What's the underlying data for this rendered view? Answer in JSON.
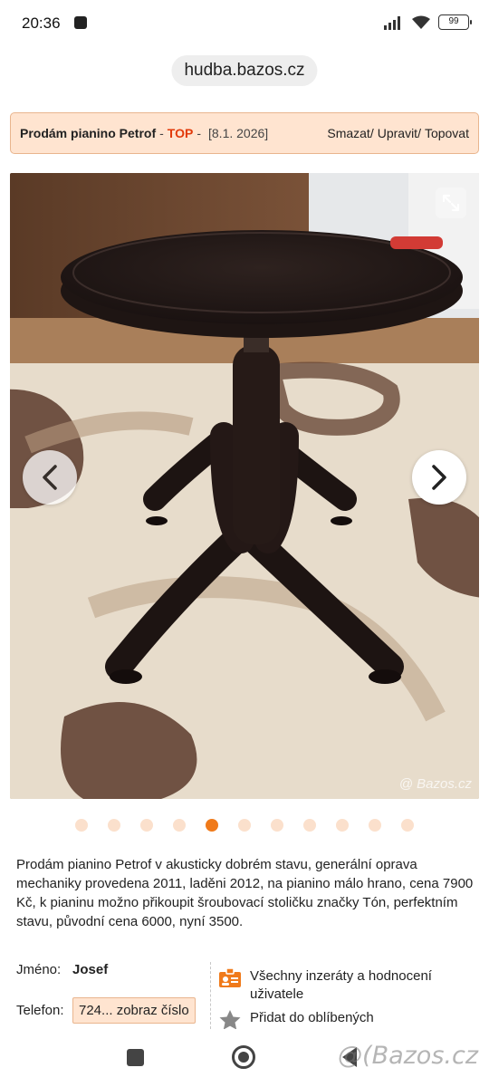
{
  "status_bar": {
    "time": "20:36",
    "battery": "99",
    "icons": [
      "signal-icon",
      "wifi-icon",
      "battery-icon"
    ]
  },
  "browser": {
    "url": "hudba.bazos.cz"
  },
  "listing": {
    "title": "Prodám pianino Petrof",
    "separator": "-",
    "top_badge": "TOP",
    "separator2": "-",
    "date": "[8.1. 2026]",
    "actions": [
      "Smazat/",
      "Upravit/",
      "Topovat"
    ]
  },
  "gallery": {
    "watermark": "Bazos.cz",
    "total_images": 11,
    "active_index": 4
  },
  "description": "Prodám pianino Petrof v akusticky dobrém stavu, generální oprava mechaniky provedena 2011, laděni 2012, na pianino málo hrano, cena 7900 Kč, k pianinu možno přikoupit šroubovací stoličku značky Tón, perfektním stavu, původní cena 6000, nyní 3500.",
  "seller": {
    "name_label": "Jméno:",
    "name": "Josef",
    "phone_label": "Telefon:",
    "phone_button": "724... zobraz číslo"
  },
  "links": {
    "all_ads": "Všechny inzeráty a hodnocení uživatele",
    "favorite": "Přidat do oblíbených"
  },
  "colors": {
    "accent": "#f07a1a",
    "title_bg": "#ffe4d0",
    "top_red": "#e23a0a"
  },
  "nav_watermark": "Bazos.cz"
}
